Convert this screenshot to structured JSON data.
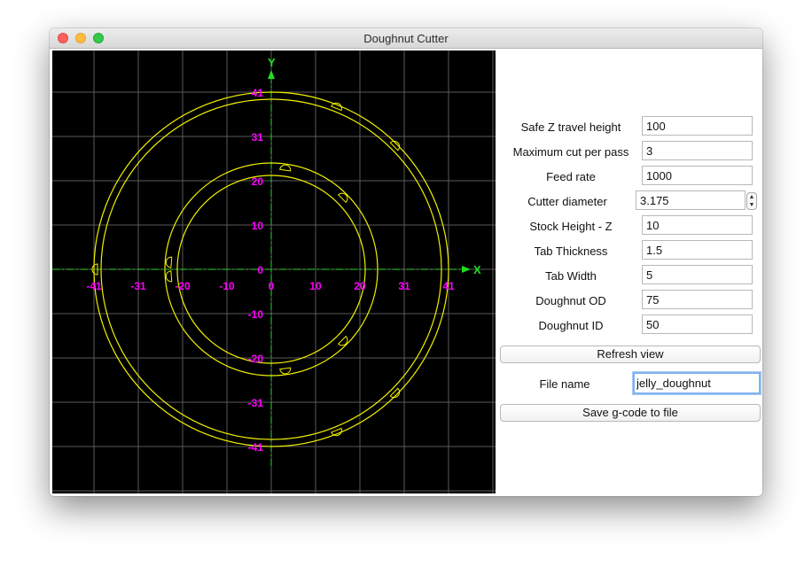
{
  "window": {
    "title": "Doughnut Cutter"
  },
  "plot": {
    "axis_x_label": "X",
    "axis_y_label": "Y",
    "x_ticks": [
      "-41",
      "-31",
      "-20",
      "-10",
      "0",
      "10",
      "20",
      "31",
      "41"
    ],
    "y_ticks": [
      "41",
      "31",
      "20",
      "10",
      "0",
      "-10",
      "-20",
      "-31",
      "-41"
    ],
    "colors": {
      "background": "#000000",
      "grid": "#5a5a5a",
      "axes": "#22dd22",
      "paths": "#f0f000",
      "tick_labels": "#ff00ff"
    }
  },
  "form": {
    "fields": [
      {
        "label": "Safe Z travel height",
        "value": "100"
      },
      {
        "label": "Maximum cut per pass",
        "value": "3"
      },
      {
        "label": "Feed rate",
        "value": "1000"
      },
      {
        "label": "Cutter diameter",
        "value": "3.175"
      },
      {
        "label": "Stock Height - Z",
        "value": "10"
      },
      {
        "label": "Tab Thickness",
        "value": "1.5"
      },
      {
        "label": "Tab Width",
        "value": "5"
      },
      {
        "label": "Doughnut OD",
        "value": "75"
      },
      {
        "label": "Doughnut ID",
        "value": "50"
      }
    ],
    "refresh_button": "Refresh view",
    "file_name_label": "File name",
    "file_name_value": "jelly_doughnut",
    "save_button": "Save g-code to file"
  }
}
